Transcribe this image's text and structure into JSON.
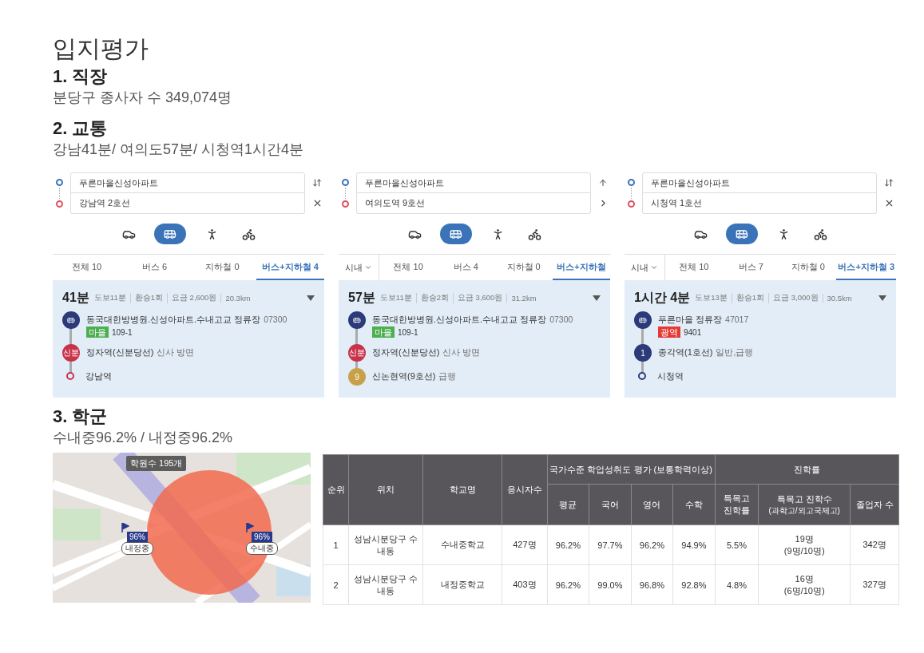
{
  "title": "입지평가",
  "work": {
    "heading": "1. 직장",
    "summary": "분당구 종사자 수 349,074명"
  },
  "transit": {
    "heading": "2. 교통",
    "summary": "강남41분/ 여의도57분/ 시청역1시간4분",
    "routes": [
      {
        "origin": "푸른마을신성아파트",
        "destination": "강남역 2호선",
        "actions": [
          {
            "kind": "swap"
          },
          {
            "kind": "close"
          }
        ],
        "modes": [
          {
            "kind": "car",
            "selected": false
          },
          {
            "kind": "bus",
            "selected": true
          },
          {
            "kind": "walk",
            "selected": false
          },
          {
            "kind": "bike",
            "selected": false
          }
        ],
        "tabs": [
          {
            "label": "전체 10",
            "selected": false
          },
          {
            "label": "버스 6",
            "selected": false
          },
          {
            "label": "지하철 0",
            "selected": false
          },
          {
            "label": "버스+지하철 4",
            "selected": true
          }
        ],
        "result": {
          "duration": "41분",
          "details": [
            "도보11분",
            "환승1회",
            "요금 2,600원",
            "20.3km"
          ],
          "steps": [
            {
              "kind": "bus",
              "color": "#2b3a78",
              "name": "동국대한방병원.신성아파트.수내고교 정류장",
              "note": "07300",
              "tag": {
                "label": "마을",
                "color": "#4caf50"
              },
              "route": "109-1"
            },
            {
              "kind": "badge",
              "color": "#c8334b",
              "badge": "신분",
              "name": "정자역(신분당선)",
              "note": "신사 방면"
            },
            {
              "kind": "end",
              "color": "#c8334b",
              "name": "강남역"
            }
          ]
        }
      },
      {
        "origin": "푸른마을신성아파트",
        "destination": "여의도역 9호선",
        "actions": [
          {
            "kind": "up"
          },
          {
            "kind": "next"
          }
        ],
        "region": "시내",
        "modes": [
          {
            "kind": "car",
            "selected": false
          },
          {
            "kind": "bus",
            "selected": true
          },
          {
            "kind": "walk",
            "selected": false
          },
          {
            "kind": "bike",
            "selected": false
          }
        ],
        "tabs": [
          {
            "label": "전체 10",
            "selected": false
          },
          {
            "label": "버스 4",
            "selected": false
          },
          {
            "label": "지하철 0",
            "selected": false
          },
          {
            "label": "버스+지하철",
            "selected": true
          }
        ],
        "result": {
          "duration": "57분",
          "details": [
            "도보11분",
            "환승2회",
            "요금 3,600원",
            "31.2km"
          ],
          "steps": [
            {
              "kind": "bus",
              "color": "#2b3a78",
              "name": "동국대한방병원.신성아파트.수내고교 정류장",
              "note": "07300",
              "tag": {
                "label": "마을",
                "color": "#4caf50"
              },
              "route": "109-1"
            },
            {
              "kind": "badge",
              "color": "#c8334b",
              "badge": "신분",
              "name": "정자역(신분당선)",
              "note": "신사 방면"
            },
            {
              "kind": "badge",
              "color": "#c9a04a",
              "badge": "9",
              "name": "신논현역(9호선)",
              "note": "급행"
            }
          ]
        }
      },
      {
        "origin": "푸른마을신성아파트",
        "destination": "시청역 1호선",
        "actions": [
          {
            "kind": "swap"
          },
          {
            "kind": "close"
          }
        ],
        "region": "시내",
        "modes": [
          {
            "kind": "car",
            "selected": false
          },
          {
            "kind": "bus",
            "selected": true
          },
          {
            "kind": "walk",
            "selected": false
          },
          {
            "kind": "bike",
            "selected": false
          }
        ],
        "tabs": [
          {
            "label": "전체 10",
            "selected": false
          },
          {
            "label": "버스 7",
            "selected": false
          },
          {
            "label": "지하철 0",
            "selected": false
          },
          {
            "label": "버스+지하철 3",
            "selected": true
          }
        ],
        "result": {
          "duration": "1시간 4분",
          "details": [
            "도보13분",
            "환승1회",
            "요금 3,000원",
            "30.5km"
          ],
          "steps": [
            {
              "kind": "bus",
              "color": "#2b3a78",
              "name": "푸른마을 정류장",
              "note": "47017",
              "tag": {
                "label": "광역",
                "color": "#e53935"
              },
              "route": "9401"
            },
            {
              "kind": "badge",
              "color": "#2b3a78",
              "badge": "1",
              "name": "종각역(1호선)",
              "note": "일반,급행"
            },
            {
              "kind": "end",
              "color": "#2b3a78",
              "name": "시청역"
            }
          ]
        }
      }
    ]
  },
  "school": {
    "heading": "3. 학군",
    "summary": "수내중96.2% / 내정중96.2%",
    "map": {
      "kind": "picture",
      "academy_label": "학원수 195개",
      "markers": [
        {
          "rate": "96%",
          "name": "내정중"
        },
        {
          "rate": "96%",
          "name": "수내중"
        }
      ]
    },
    "table": {
      "columns": [
        {
          "label": "순위"
        },
        {
          "label": "위치"
        },
        {
          "label": "학교명"
        },
        {
          "label": "응시자수"
        }
      ],
      "groups": [
        {
          "label": "국가수준 학업성취도 평가 (보통학력이상)",
          "columns": [
            {
              "label": "평균"
            },
            {
              "label": "국어"
            },
            {
              "label": "영어"
            },
            {
              "label": "수학"
            }
          ]
        },
        {
          "label": "진학률",
          "columns": [
            {
              "lines": [
                "특목고",
                "진학률"
              ]
            },
            {
              "label": "특목고 진학수",
              "sub": "(과학고/외고국제고)"
            },
            {
              "label": "졸업자 수"
            }
          ]
        }
      ],
      "rows": [
        {
          "cells": [
            "1",
            "성남시분당구 수내동",
            "수내중학교",
            "427명",
            "96.2%",
            "97.7%",
            "96.2%",
            "94.9%",
            "5.5%",
            [
              "19명",
              "(9명/10명)"
            ],
            "342명"
          ]
        },
        {
          "cells": [
            "2",
            "성남시분당구 수내동",
            "내정중학교",
            "403명",
            "96.2%",
            "99.0%",
            "96.8%",
            "92.8%",
            "4.8%",
            [
              "16명",
              "(6명/10명)"
            ],
            "327명"
          ]
        }
      ]
    }
  }
}
